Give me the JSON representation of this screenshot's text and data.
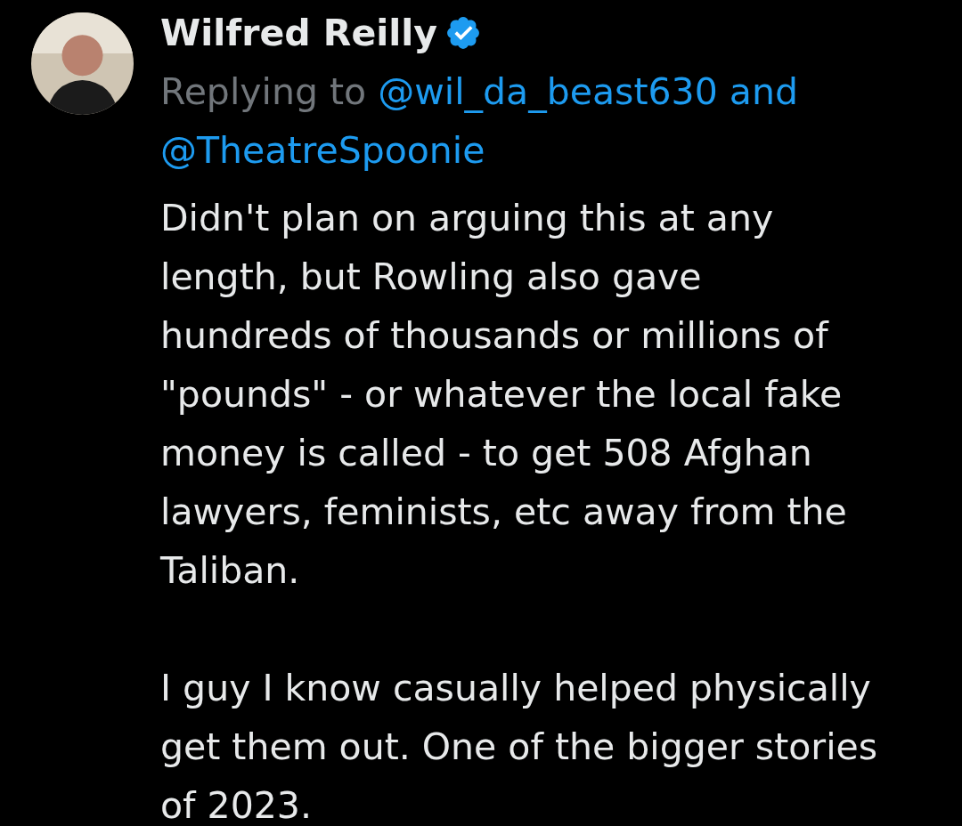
{
  "author": {
    "name": "Wilfred Reilly",
    "verified": true
  },
  "reply": {
    "prefix": "Replying to",
    "handles": [
      "@wil_da_beast630",
      "@TheatreSpoonie"
    ],
    "joiner": "and"
  },
  "paragraphs": [
    "Didn't plan on arguing this at any\nlength, but Rowling also gave\nhundreds of thousands or millions of\n\"pounds\" - or whatever the local fake\nmoney is called - to get 508 Afghan\nlawyers, feminists, etc away from the\nTaliban.",
    "I guy I know casually helped physically\nget them out. One of the bigger stories\nof 2023."
  ]
}
